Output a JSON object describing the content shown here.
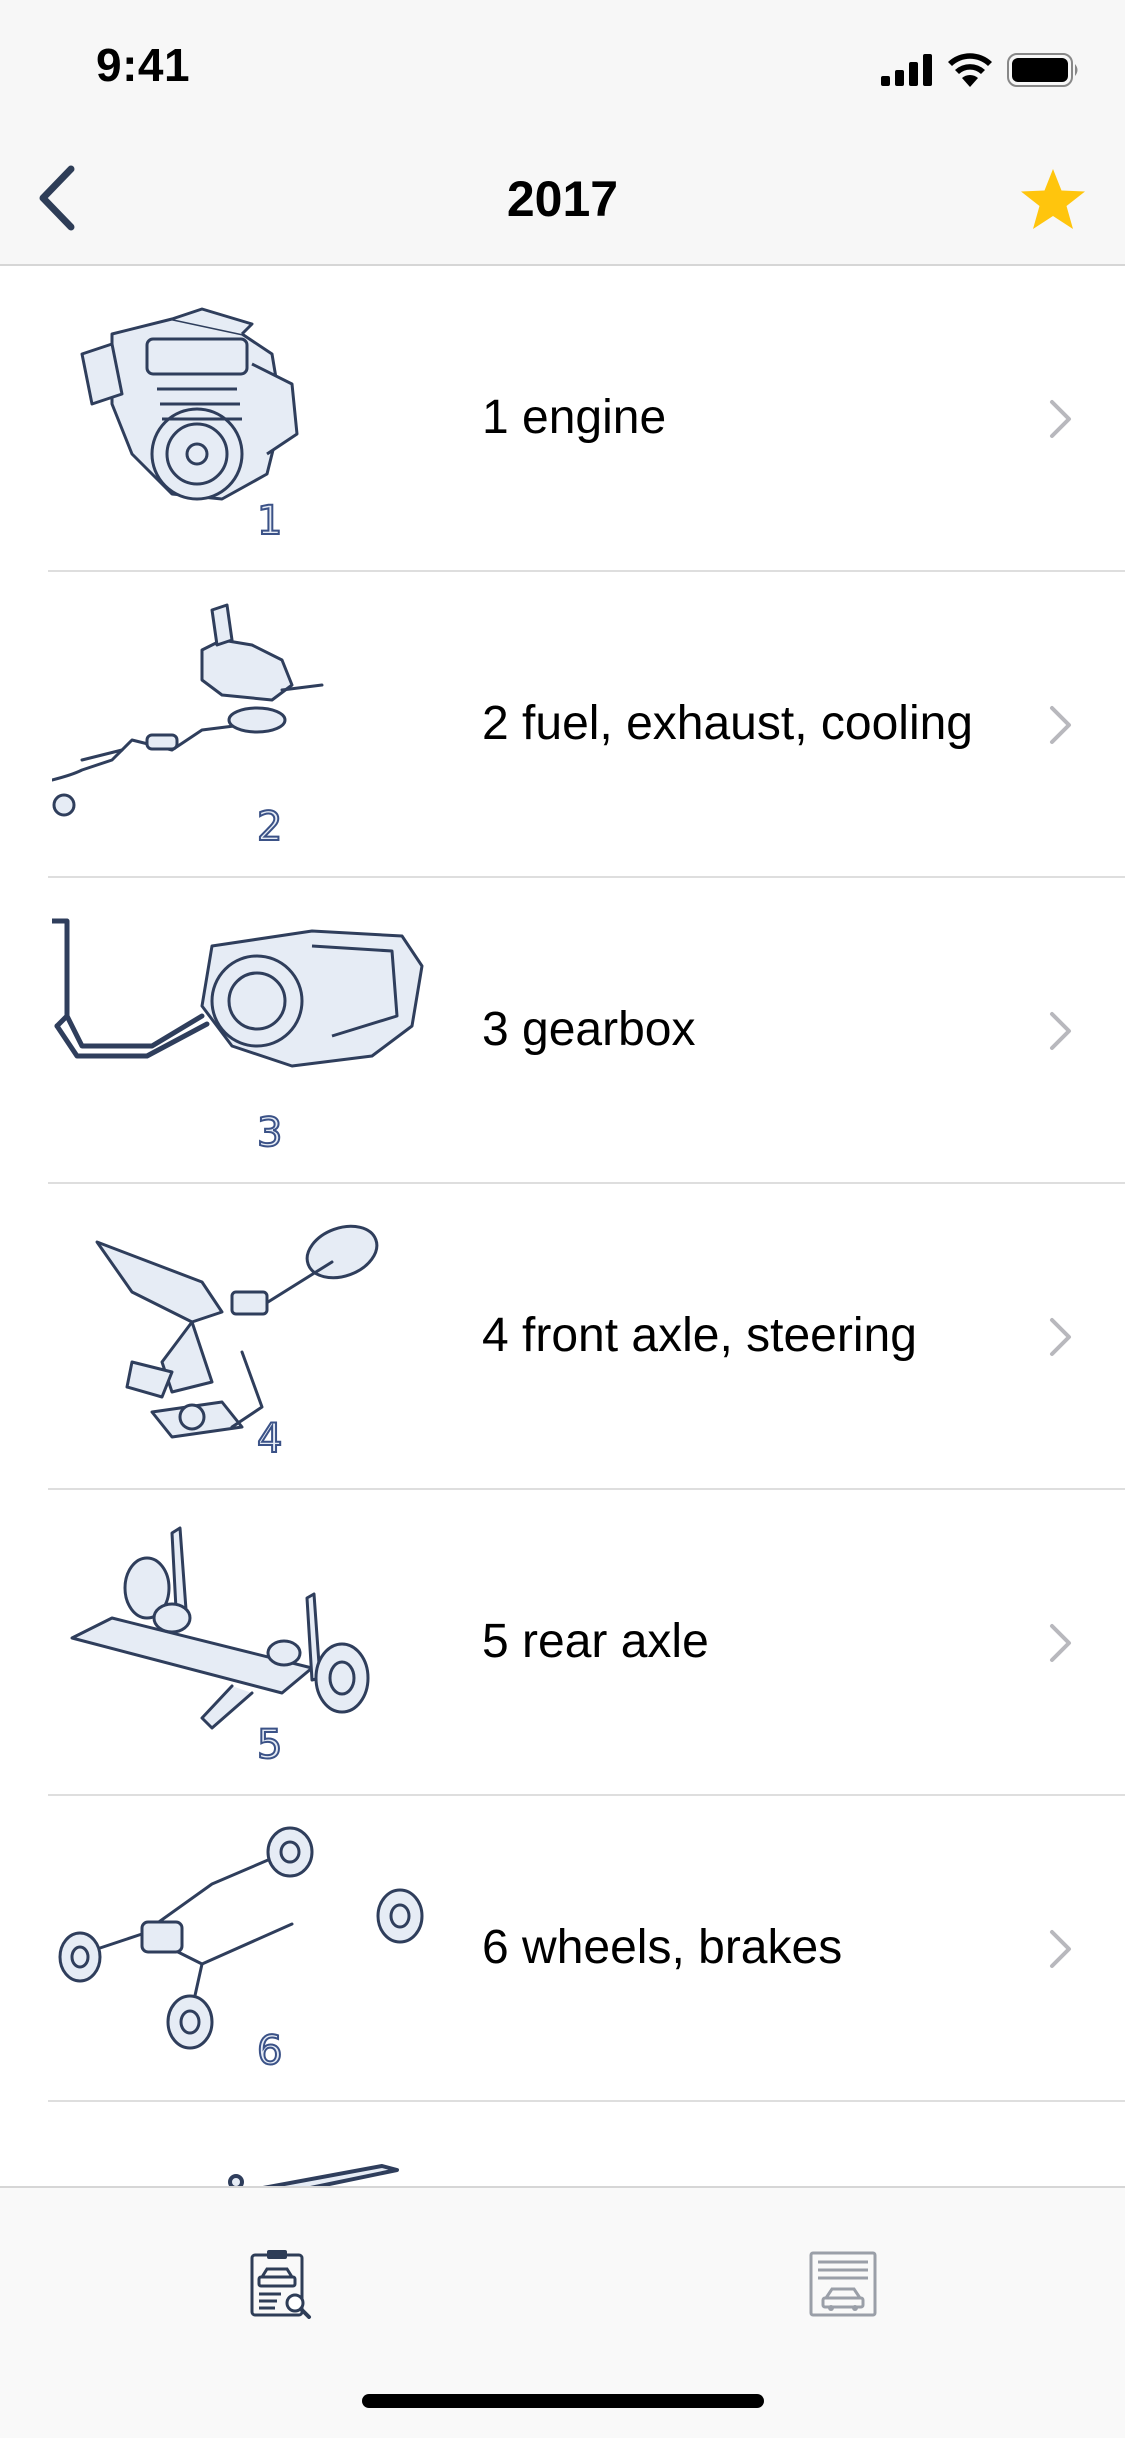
{
  "status_bar": {
    "time": "9:41",
    "icons": [
      "cellular-signal-icon",
      "wifi-icon",
      "battery-icon"
    ]
  },
  "nav": {
    "title": "2017",
    "back_icon": "chevron-left-icon",
    "favorite_icon": "star-icon"
  },
  "colors": {
    "accent_star": "#FFC50D",
    "nav_blue": "#2E3D57",
    "illustration_stroke": "#2F3E5C",
    "illustration_fill": "#E6ECF5",
    "chevron": "#B8B8BD",
    "separator": "#DEDEDE"
  },
  "categories": [
    {
      "label": "1 engine",
      "badge": "1",
      "icon": "engine-illustration"
    },
    {
      "label": "2 fuel, exhaust, cooling",
      "badge": "2",
      "icon": "fuel-exhaust-illustration"
    },
    {
      "label": "3 gearbox",
      "badge": "3",
      "icon": "gearbox-illustration"
    },
    {
      "label": "4 front axle, steering",
      "badge": "4",
      "icon": "steering-illustration"
    },
    {
      "label": "5 rear axle",
      "badge": "5",
      "icon": "rear-axle-illustration"
    },
    {
      "label": "6 wheels, brakes",
      "badge": "6",
      "icon": "wheels-brakes-illustration"
    }
  ],
  "tabbar": {
    "tabs": [
      {
        "icon": "parts-catalog-clipboard-icon",
        "active": true
      },
      {
        "icon": "garage-icon",
        "active": false
      }
    ]
  }
}
